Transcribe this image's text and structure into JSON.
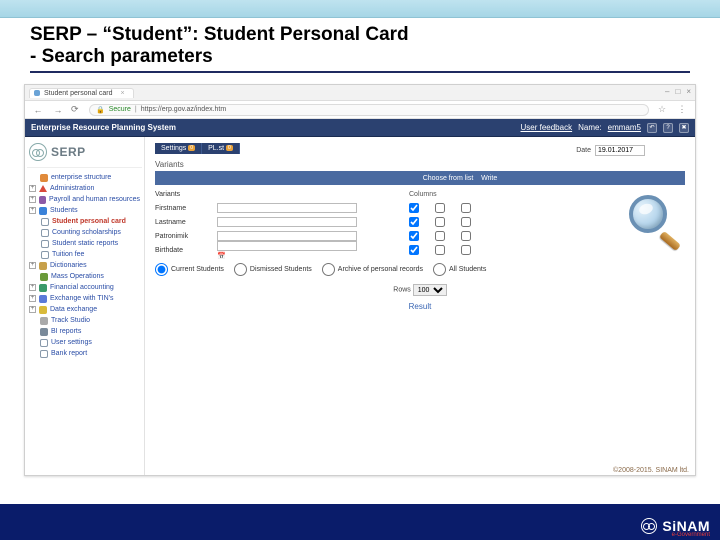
{
  "slide": {
    "title_line1": "SERP – “Student”: Student Personal Card",
    "title_line2": "- Search parameters"
  },
  "browser": {
    "tab_title": "Student personal card",
    "secure_label": "Secure",
    "url": "https://erp.gov.az/index.htm",
    "win_min": "–",
    "win_max": "□",
    "win_close": "×"
  },
  "sysbar": {
    "title": "Enterprise Resource Planning System",
    "user_feedback": "User feedback",
    "name_label": "Name:",
    "name_value": "emmam5"
  },
  "logo_text": "SERP",
  "sidebar": {
    "items": [
      {
        "label": "enterprise structure",
        "icon": "i-org",
        "expandable": false
      },
      {
        "label": "Administration",
        "icon": "i-adm",
        "expandable": true
      },
      {
        "label": "Payroll and human resources",
        "icon": "i-phr",
        "expandable": true
      },
      {
        "label": "Students",
        "icon": "i-stu",
        "expandable": true
      },
      {
        "label": "Student personal card",
        "icon": "i-doc",
        "sub": true,
        "active": true
      },
      {
        "label": "Counting scholarships",
        "icon": "i-doc",
        "sub": true
      },
      {
        "label": "Student static reports",
        "icon": "i-doc",
        "sub": true
      },
      {
        "label": "Tuition fee",
        "icon": "i-doc",
        "sub": true
      },
      {
        "label": "Dictionaries",
        "icon": "i-dic",
        "expandable": true
      },
      {
        "label": "Mass Operations",
        "icon": "i-mass",
        "expandable": false
      },
      {
        "label": "Financial accounting",
        "icon": "i-fin",
        "expandable": true
      },
      {
        "label": "Exchange with TIN's",
        "icon": "i-exc",
        "expandable": true
      },
      {
        "label": "Data exchange",
        "icon": "i-data",
        "expandable": true
      },
      {
        "label": "Track Studio",
        "icon": "i-trk",
        "expandable": false
      },
      {
        "label": "BI reports",
        "icon": "i-rep",
        "expandable": false
      },
      {
        "label": "User settings",
        "icon": "i-doc",
        "expandable": false
      },
      {
        "label": "Bank report",
        "icon": "i-doc",
        "expandable": false
      }
    ]
  },
  "main": {
    "tabs": [
      {
        "label": "Settings",
        "badge": "0"
      },
      {
        "label": "PL.st",
        "badge": "0"
      }
    ],
    "date_label": "Date",
    "date_value": "19.01.2017",
    "variants_title": "Variants",
    "panel": {
      "col_choose": "Choose from list",
      "col_write": "Write"
    },
    "grid": {
      "header": {
        "variants": "Variants",
        "columns": "Columns"
      },
      "rows": [
        {
          "label": "Firstname",
          "value": "",
          "cb1": true,
          "cb2": false,
          "cb3": false
        },
        {
          "label": "Lastname",
          "value": "",
          "cb1": true,
          "cb2": false,
          "cb3": false
        },
        {
          "label": "Patronimik",
          "value": "",
          "cb1": true,
          "cb2": false,
          "cb3": false
        },
        {
          "label": "Birthdate",
          "value": "",
          "calendar": true,
          "cb1": true,
          "cb2": false,
          "cb3": false
        }
      ]
    },
    "radios": {
      "opt1": "Current Students",
      "opt2": "Dismissed Students",
      "opt3": "Archive of personal records",
      "opt4": "All Students"
    },
    "rows_label": "Rows",
    "rows_value": "100",
    "result_label": "Result"
  },
  "copyright": "©2008-2015. SINAM ltd.",
  "footer": {
    "brand": "SiNAM",
    "tag": "e-Government"
  }
}
